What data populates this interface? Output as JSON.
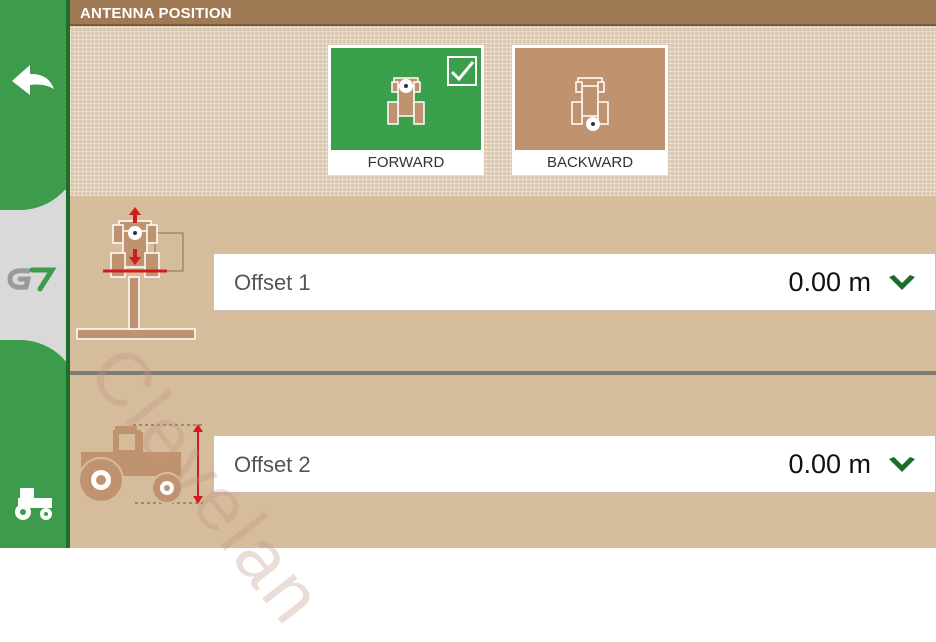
{
  "header": {
    "title": "ANTENNA POSITION"
  },
  "sidebar": {
    "back_icon": "back-arrow-icon",
    "brand_logo": "G7",
    "nav_icon": "tractor-icon"
  },
  "position_options": [
    {
      "label": "FORWARD",
      "selected": true,
      "icon": "tractor-top-view-antenna-front-icon"
    },
    {
      "label": "BACKWARD",
      "selected": false,
      "icon": "tractor-top-view-antenna-rear-icon"
    }
  ],
  "offsets": [
    {
      "label": "Offset 1",
      "value": "0.00 m",
      "icon": "chevron-down-icon"
    },
    {
      "label": "Offset 2",
      "value": "0.00 m",
      "icon": "chevron-down-icon"
    }
  ],
  "watermark": "Clevelan",
  "colors": {
    "accent_green": "#3aa04c",
    "brown": "#a07a55",
    "tan": "#d5bd9c",
    "check_green": "#1a6e2c"
  }
}
